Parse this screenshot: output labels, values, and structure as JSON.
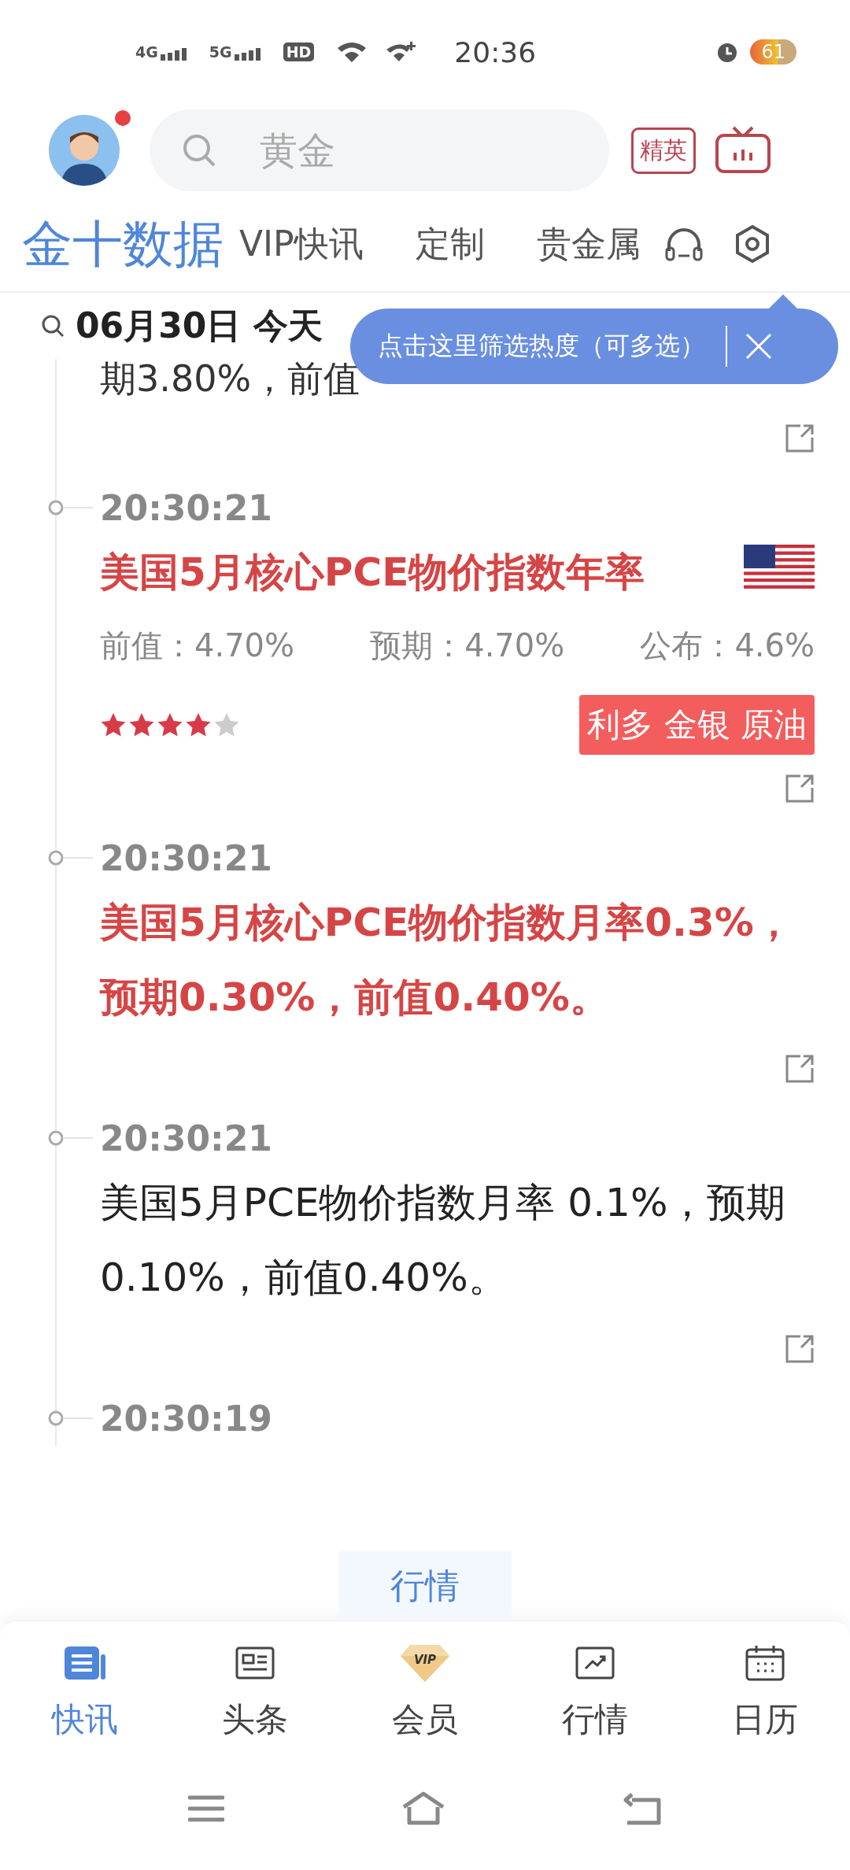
{
  "status_bar": {
    "network": [
      "4G",
      "5G",
      "HD"
    ],
    "time": "20:36",
    "battery": "61"
  },
  "header": {
    "search": {
      "placeholder": "黄金"
    },
    "elite_badge": "精英",
    "has_notification": true
  },
  "nav": {
    "logo": "金十数据",
    "tabs": [
      "VIP快讯",
      "定制",
      "贵金属"
    ]
  },
  "date_bar": {
    "date": "06月30日 今天"
  },
  "tooltip": {
    "text": "点击这里筛选热度（可多选）"
  },
  "partial_item": {
    "text": "期3.80%，前值"
  },
  "items": [
    {
      "kind": "data",
      "time": "20:30:21",
      "title": "美国5月核心PCE物价指数年率",
      "important": true,
      "values": [
        "前值：4.70%",
        "预期：4.70%",
        "公布：4.6%"
      ],
      "stars": 4,
      "tag": "利多 金银 原油"
    },
    {
      "kind": "text",
      "time": "20:30:21",
      "title": "美国5月核心PCE物价指数月率0.3%，预期0.30%，前值0.40%。",
      "important": true
    },
    {
      "kind": "text",
      "time": "20:30:21",
      "title": "美国5月PCE物价指数月率 0.1%，预期0.10%，前值0.40%。",
      "important": false
    },
    {
      "kind": "time_only",
      "time": "20:30:19"
    }
  ],
  "floating_chip": "行情",
  "bottom_tabs": [
    {
      "label": "快讯",
      "selected": true
    },
    {
      "label": "头条",
      "selected": false
    },
    {
      "label": "会员",
      "selected": false,
      "icon_text": "VIP"
    },
    {
      "label": "行情",
      "selected": false
    },
    {
      "label": "日历",
      "selected": false
    }
  ]
}
